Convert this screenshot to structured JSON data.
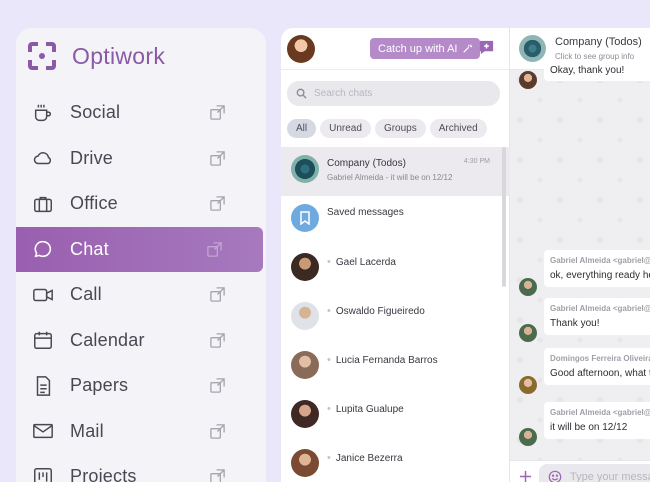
{
  "brand": {
    "name": "Optiwork",
    "accent": "#8a5aa6"
  },
  "nav": {
    "items": [
      {
        "label": "Social",
        "icon": "coffee-icon",
        "active": false
      },
      {
        "label": "Drive",
        "icon": "cloud-icon",
        "active": false
      },
      {
        "label": "Office",
        "icon": "briefcase-icon",
        "active": false
      },
      {
        "label": "Chat",
        "icon": "chat-bubble-icon",
        "active": true
      },
      {
        "label": "Call",
        "icon": "video-camera-icon",
        "active": false
      },
      {
        "label": "Calendar",
        "icon": "calendar-icon",
        "active": false
      },
      {
        "label": "Papers",
        "icon": "document-icon",
        "active": false
      },
      {
        "label": "Mail",
        "icon": "mail-icon",
        "active": false
      },
      {
        "label": "Projects",
        "icon": "kanban-icon",
        "active": false
      }
    ]
  },
  "chat_list": {
    "catchup_label": "Catch up with AI",
    "search_placeholder": "Search chats",
    "filters": [
      "All",
      "Unread",
      "Groups",
      "Archived"
    ],
    "active_filter": "All",
    "rows": [
      {
        "name": "Company (Todos)",
        "time": "4:30 PM",
        "preview": "Gabriel Almeida - it will be on 12/12",
        "selected": true,
        "avatar": "group-logo"
      },
      {
        "name": "Saved messages",
        "time": "",
        "preview": "",
        "selected": false,
        "avatar": "bookmark-icon"
      },
      {
        "name": "Gael Lacerda",
        "time": "",
        "preview": "",
        "selected": false,
        "avatar": "person"
      },
      {
        "name": "Oswaldo Figueiredo",
        "time": "",
        "preview": "",
        "selected": false,
        "avatar": "person"
      },
      {
        "name": "Lucia Fernanda Barros",
        "time": "",
        "preview": "",
        "selected": false,
        "avatar": "person"
      },
      {
        "name": "Lupita Gualupe",
        "time": "",
        "preview": "",
        "selected": false,
        "avatar": "person"
      },
      {
        "name": "Janice Bezerra",
        "time": "",
        "preview": "",
        "selected": false,
        "avatar": "person"
      }
    ]
  },
  "conversation": {
    "title": "Company (Todos)",
    "subtitle": "Click to see group info",
    "messages": [
      {
        "from": "",
        "text": "Okay, thank you!"
      },
      {
        "from": "Gabriel Almeida <gabriel@",
        "text": "ok, everything ready here"
      },
      {
        "from": "Gabriel Almeida <gabriel@",
        "text": "Thank you!"
      },
      {
        "from": "Domingos Ferreira Oliveira",
        "text": "Good afternoon, what time"
      },
      {
        "from": "Gabriel Almeida <gabriel@",
        "text": "it will be on 12/12"
      }
    ],
    "composer_placeholder": "Type your message"
  }
}
